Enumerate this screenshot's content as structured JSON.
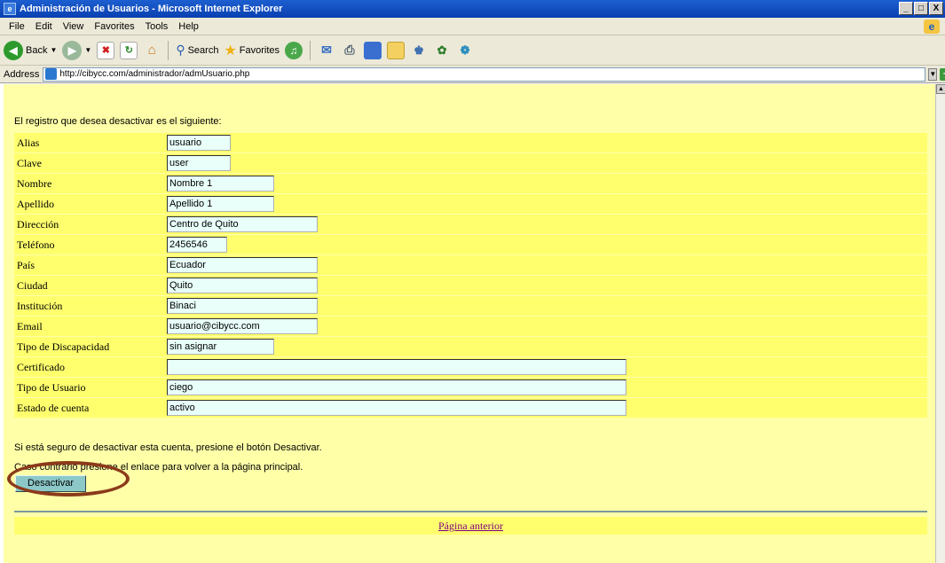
{
  "window": {
    "title": "Administración de Usuarios - Microsoft Internet Explorer",
    "controls": [
      "_",
      "□",
      "X"
    ]
  },
  "menubar": {
    "items": [
      "File",
      "Edit",
      "View",
      "Favorites",
      "Tools",
      "Help"
    ]
  },
  "toolbar": {
    "back_label": "Back",
    "search_label": "Search",
    "favorites_label": "Favorites"
  },
  "addressbar": {
    "label": "Address",
    "url": "http://cibycc.com/administrador/admUsuario.php",
    "go_label": "Go"
  },
  "page": {
    "intro": "El registro que desea desactivar es el siguiente:",
    "fields": [
      {
        "label": "Alias",
        "value": "usuario"
      },
      {
        "label": "Clave",
        "value": "user"
      },
      {
        "label": "Nombre",
        "value": "Nombre 1"
      },
      {
        "label": "Apellido",
        "value": "Apellido 1"
      },
      {
        "label": "Dirección",
        "value": "Centro de Quito"
      },
      {
        "label": "Teléfono",
        "value": "2456546"
      },
      {
        "label": "País",
        "value": "Ecuador"
      },
      {
        "label": "Ciudad",
        "value": "Quito"
      },
      {
        "label": "Institución",
        "value": "Binaci"
      },
      {
        "label": "Email",
        "value": "usuario@cibycc.com"
      },
      {
        "label": "Tipo de Discapacidad",
        "value": "sin asignar"
      },
      {
        "label": "Certificado",
        "value": ""
      },
      {
        "label": "Tipo de Usuario",
        "value": "ciego"
      },
      {
        "label": "Estado de cuenta",
        "value": "activo"
      }
    ],
    "confirm_text": "Si está seguro de desactivar esta cuenta, presione el botón Desactivar.",
    "cancel_text": "Caso contrario presione el enlace para volver a la página principal.",
    "deactivate_label": "Desactivar",
    "back_link": "Página anterior"
  },
  "colors": {
    "page_background": "#ffffa8",
    "row_background": "#ffff6e",
    "input_background": "#e8fffa",
    "button_background": "#8cc8c8",
    "annotation": "#8b3a1a"
  }
}
